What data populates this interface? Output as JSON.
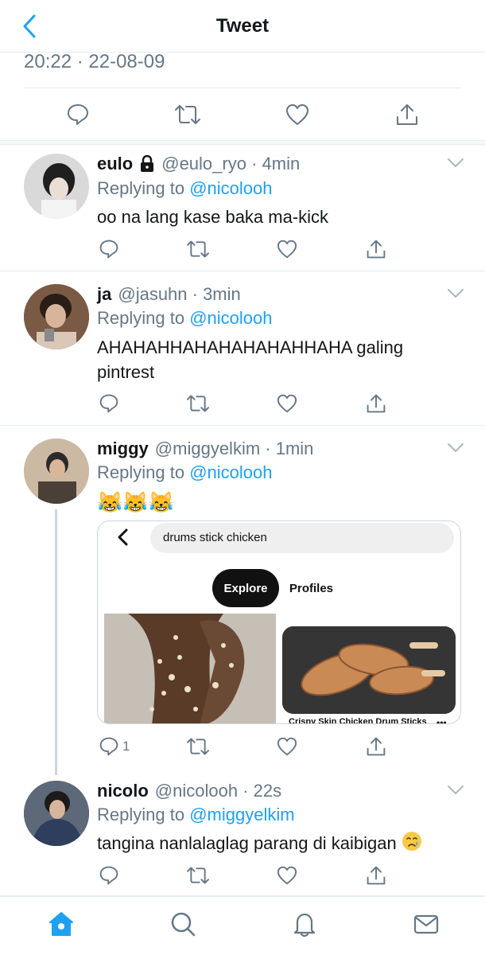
{
  "header": {
    "title": "Tweet",
    "back_icon": "chevron-left-icon"
  },
  "main_tweet": {
    "timestamp": "20:22 · 22-08-09"
  },
  "colors": {
    "accent": "#1da1f2",
    "secondary_text": "#657786",
    "divider": "#e6ecf0"
  },
  "replies": [
    {
      "name": "eulo",
      "handle": "@eulo_ryo · 4min",
      "replying_prefix": "Replying to",
      "replying_to": "@nicolooh",
      "text": "oo na lang kase baka ma-kick"
    },
    {
      "name": "ja",
      "handle": "@jasuhn · 3min",
      "replying_prefix": "Replying to",
      "replying_to": "@nicolooh",
      "text_line1": "AHAHAHHAHAHAHAHAHHAHA galing",
      "text_line2": "pintrest"
    },
    {
      "name": "miggy",
      "handle": "@miggyelkim · 1min",
      "replying_prefix": "Replying to",
      "replying_to": "@nicolooh",
      "emojis": [
        "😹",
        "😹",
        "😹"
      ],
      "reply_count": "1",
      "card": {
        "search_text": "drums stick chicken",
        "explore_label": "Explore",
        "profiles_label": "Profiles",
        "caption": "Crispy Skin Chicken Drum Sticks",
        "more_label": "•••"
      }
    },
    {
      "name": "nicolo",
      "handle": "@nicolooh · 22s",
      "replying_prefix": "Replying to",
      "replying_to": "@miggyelkim",
      "text": "tangina nanlalaglag parang di kaibigan"
    }
  ],
  "tabbar": {
    "icons": [
      "home-icon",
      "search-icon",
      "notifications-icon",
      "messages-icon"
    ],
    "active": "home-icon"
  }
}
